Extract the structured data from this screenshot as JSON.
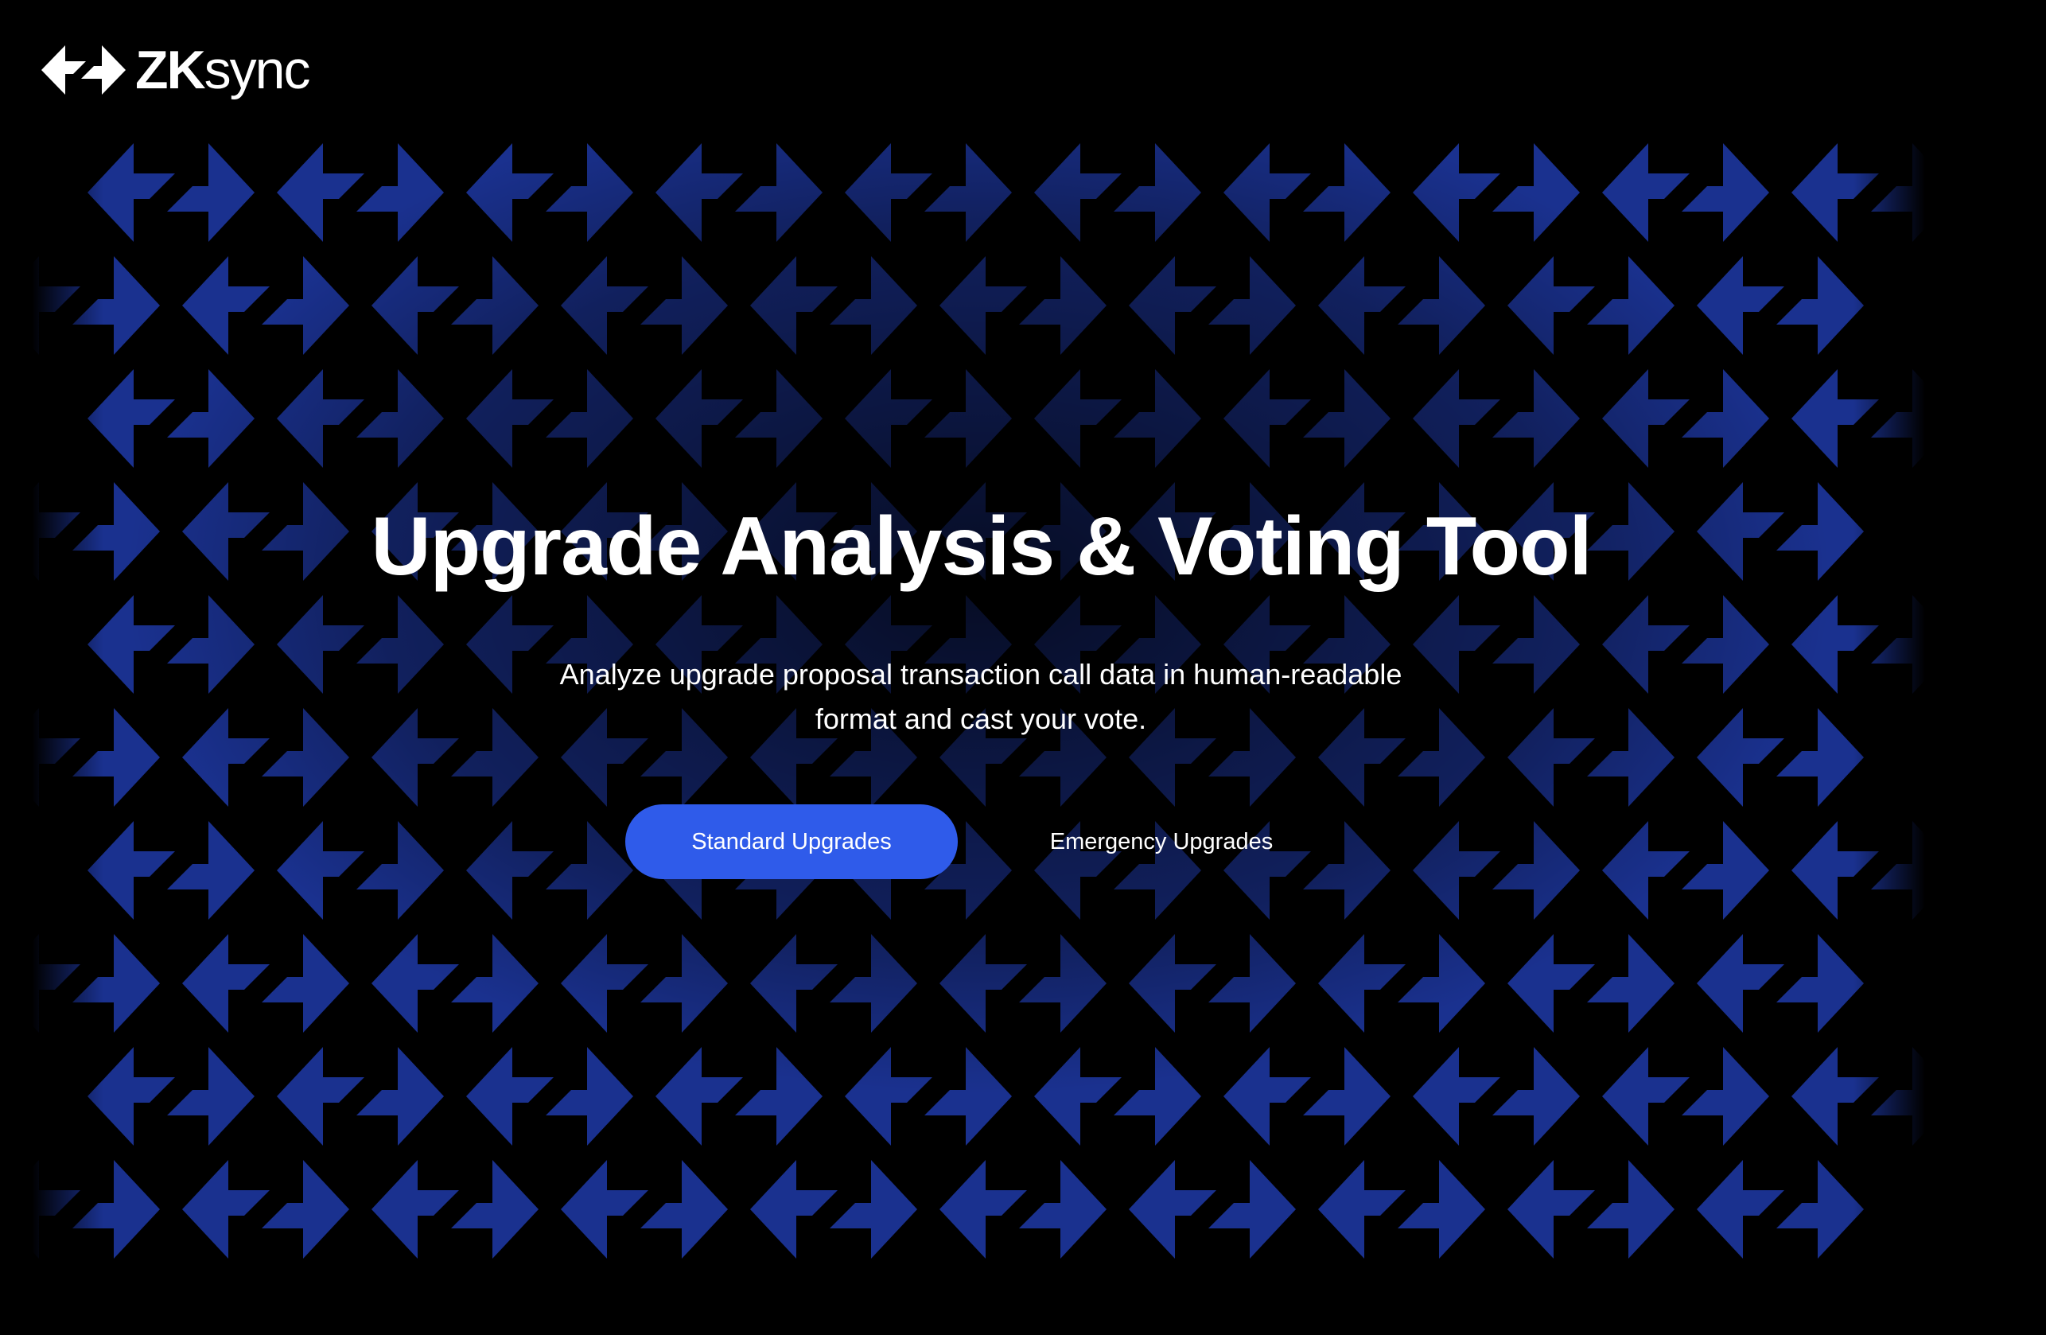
{
  "header": {
    "logo_bold": "ZK",
    "logo_light": "sync",
    "logo_icon": "zksync-arrows-icon"
  },
  "hero": {
    "title": "Upgrade Analysis & Voting Tool",
    "subtitle_line1": "Analyze upgrade proposal transaction call data in human-readable",
    "subtitle_line2": "format and cast your vote."
  },
  "actions": {
    "primary_label": "Standard Upgrades",
    "secondary_label": "Emergency Upgrades"
  },
  "colors": {
    "background": "#000000",
    "accent": "#2f5bea",
    "pattern_blue": "#1f3aa8",
    "text": "#ffffff"
  }
}
